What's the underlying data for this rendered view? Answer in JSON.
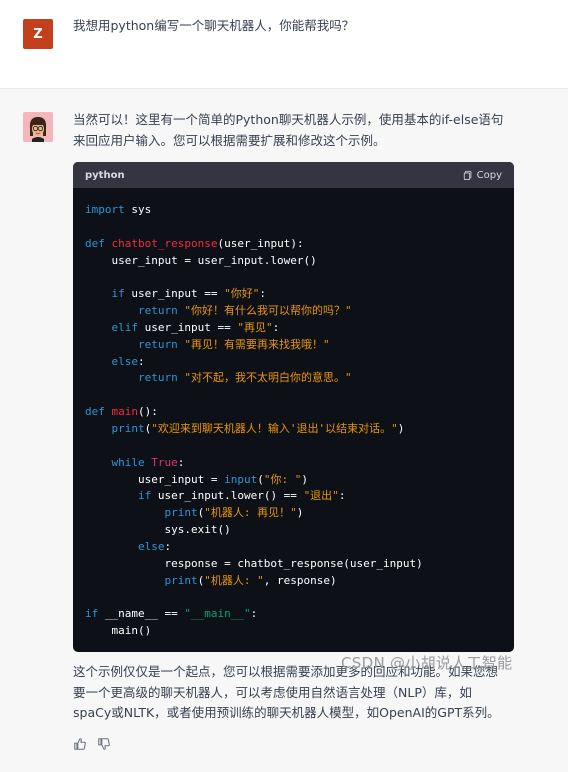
{
  "user": {
    "avatar_letter": "Z",
    "avatar_color": "#c2411c",
    "message": "我想用python编写一个聊天机器人，你能帮我吗？"
  },
  "assistant": {
    "avatar_icon": "memoji-avatar-icon",
    "intro_line1": "当然可以！这里有一个简单的Python聊天机器人示例，使用基本的if-else语句",
    "intro_line2": "来回应用户输入。您可以根据需要扩展和修改这个示例。",
    "code": {
      "language": "python",
      "copy_label": "Copy",
      "lines": [
        [
          {
            "t": "import",
            "c": "tok-kw"
          },
          {
            "t": " sys"
          }
        ],
        [],
        [
          {
            "t": "def",
            "c": "tok-kw"
          },
          {
            "t": " "
          },
          {
            "t": "chatbot_response",
            "c": "tok-fn"
          },
          {
            "t": "(user_input):"
          }
        ],
        [
          {
            "t": "    user_input = user_input.lower()"
          }
        ],
        [],
        [
          {
            "t": "    "
          },
          {
            "t": "if",
            "c": "tok-kw"
          },
          {
            "t": " user_input == "
          },
          {
            "t": "\"你好\"",
            "c": "tok-str-y"
          },
          {
            "t": ":"
          }
        ],
        [
          {
            "t": "        "
          },
          {
            "t": "return",
            "c": "tok-kw"
          },
          {
            "t": " "
          },
          {
            "t": "\"你好！有什么我可以帮你的吗？\"",
            "c": "tok-str-y"
          }
        ],
        [
          {
            "t": "    "
          },
          {
            "t": "elif",
            "c": "tok-kw"
          },
          {
            "t": " user_input == "
          },
          {
            "t": "\"再见\"",
            "c": "tok-str-y"
          },
          {
            "t": ":"
          }
        ],
        [
          {
            "t": "        "
          },
          {
            "t": "return",
            "c": "tok-kw"
          },
          {
            "t": " "
          },
          {
            "t": "\"再见！有需要再来找我哦！\"",
            "c": "tok-str-y"
          }
        ],
        [
          {
            "t": "    "
          },
          {
            "t": "else",
            "c": "tok-kw"
          },
          {
            "t": ":"
          }
        ],
        [
          {
            "t": "        "
          },
          {
            "t": "return",
            "c": "tok-kw"
          },
          {
            "t": " "
          },
          {
            "t": "\"对不起，我不太明白你的意思。\"",
            "c": "tok-str-y"
          }
        ],
        [],
        [
          {
            "t": "def",
            "c": "tok-kw"
          },
          {
            "t": " "
          },
          {
            "t": "main",
            "c": "tok-fn"
          },
          {
            "t": "():"
          }
        ],
        [
          {
            "t": "    "
          },
          {
            "t": "print",
            "c": "tok-kw"
          },
          {
            "t": "("
          },
          {
            "t": "\"欢迎来到聊天机器人！输入'退出'以结束对话。\"",
            "c": "tok-str-y"
          },
          {
            "t": ")"
          }
        ],
        [],
        [
          {
            "t": "    "
          },
          {
            "t": "while",
            "c": "tok-kw"
          },
          {
            "t": " "
          },
          {
            "t": "True",
            "c": "tok-bool"
          },
          {
            "t": ":"
          }
        ],
        [
          {
            "t": "        user_input = "
          },
          {
            "t": "input",
            "c": "tok-kw"
          },
          {
            "t": "("
          },
          {
            "t": "\"你: \"",
            "c": "tok-str-y"
          },
          {
            "t": ")"
          }
        ],
        [
          {
            "t": "        "
          },
          {
            "t": "if",
            "c": "tok-kw"
          },
          {
            "t": " user_input.lower() == "
          },
          {
            "t": "\"退出\"",
            "c": "tok-str-y"
          },
          {
            "t": ":"
          }
        ],
        [
          {
            "t": "            "
          },
          {
            "t": "print",
            "c": "tok-kw"
          },
          {
            "t": "("
          },
          {
            "t": "\"机器人: 再见！\"",
            "c": "tok-str-y"
          },
          {
            "t": ")"
          }
        ],
        [
          {
            "t": "            sys.exit()"
          }
        ],
        [
          {
            "t": "        "
          },
          {
            "t": "else",
            "c": "tok-kw"
          },
          {
            "t": ":"
          }
        ],
        [
          {
            "t": "            response = chatbot_response(user_input)"
          }
        ],
        [
          {
            "t": "            "
          },
          {
            "t": "print",
            "c": "tok-kw"
          },
          {
            "t": "("
          },
          {
            "t": "\"机器人: \"",
            "c": "tok-str-y"
          },
          {
            "t": ", response)"
          }
        ],
        [],
        [
          {
            "t": "if",
            "c": "tok-kw"
          },
          {
            "t": " __name__ == "
          },
          {
            "t": "\"__main__\"",
            "c": "tok-str"
          },
          {
            "t": ":"
          }
        ],
        [
          {
            "t": "    main()"
          }
        ]
      ]
    },
    "outro_line1": "这个示例仅仅是一个起点，您可以根据需要添加更多的回应和功能。如果您想",
    "outro_line2": "要一个更高级的聊天机器人，可以考虑使用自然语言处理（NLP）库，如",
    "outro_line3": "spaCy或NLTK，或者使用预训练的聊天机器人模型，如OpenAI的GPT系列。",
    "feedback": {
      "thumbs_up_icon": "thumbs-up-icon",
      "thumbs_down_icon": "thumbs-down-icon"
    }
  },
  "watermark": "CSDN @小胡说人工智能"
}
